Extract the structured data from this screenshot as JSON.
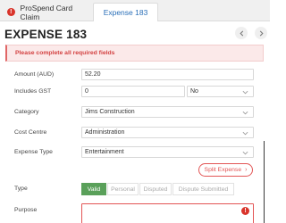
{
  "tabs": [
    {
      "label": "ProSpend Card Claim",
      "has_error": true
    },
    {
      "label": "Expense 183",
      "active": true
    }
  ],
  "header": {
    "title": "EXPENSE 183"
  },
  "alert": {
    "message": "Please complete all required fields"
  },
  "form": {
    "amount": {
      "label": "Amount (AUD)",
      "value": "52.20"
    },
    "gst": {
      "label": "Includes GST",
      "amount": "0",
      "option": "No"
    },
    "category": {
      "label": "Category",
      "value": "Jims Construction"
    },
    "cost_centre": {
      "label": "Cost Centre",
      "value": "Administration"
    },
    "expense_type": {
      "label": "Expense Type",
      "value": "Entertainment"
    },
    "split_label": "Split Expense",
    "type": {
      "label": "Type",
      "options": [
        "Valid",
        "Personal",
        "Disputed",
        "Dispute Submitted"
      ],
      "selected": "Valid"
    },
    "purpose": {
      "label": "Purpose",
      "value": ""
    }
  },
  "colors": {
    "error": "#d9342b",
    "valid": "#5aa05a",
    "tab_active": "#2a6fb8"
  }
}
